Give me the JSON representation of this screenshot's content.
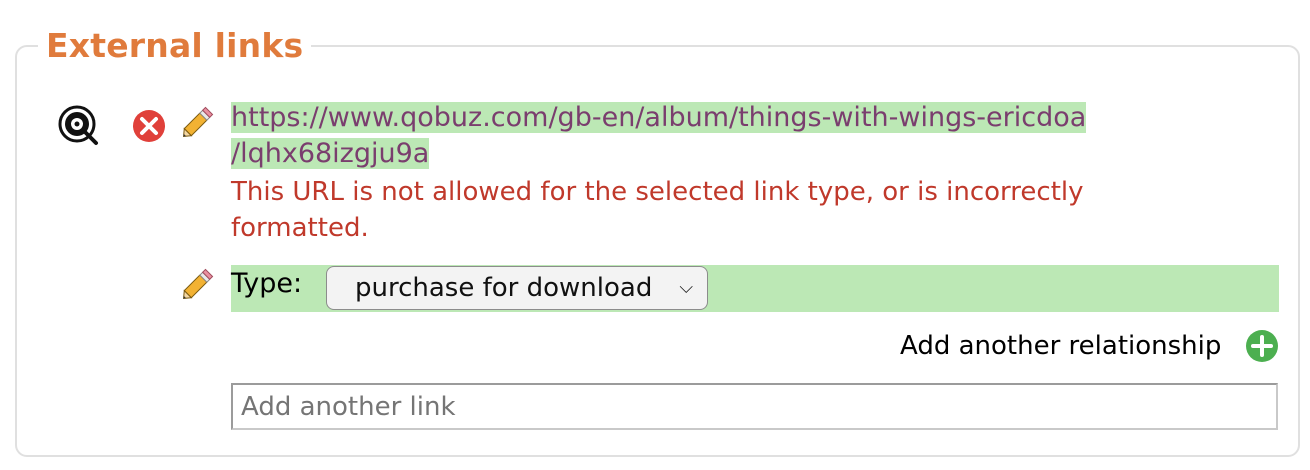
{
  "section": {
    "title": "External links"
  },
  "link": {
    "url_line1": "https://www.qobuz.com/gb-en/album/things-with-wings-ericdoa",
    "url_line2": "/lqhx68izgju9a",
    "error_line1": "This URL is not allowed for the selected link type, or is incorrectly",
    "error_line2": "formatted.",
    "site_icon": "qobuz-icon",
    "remove_icon": "remove-circle-icon",
    "edit_icon": "pencil-icon"
  },
  "relationship": {
    "type_label": "Type:",
    "type_value": "purchase for download",
    "add_another_label": "Add another relationship",
    "add_icon": "plus-circle-icon"
  },
  "add_link": {
    "placeholder": "Add another link"
  },
  "colors": {
    "accent": "#e07b3c",
    "highlight": "#bce8b5",
    "error": "#c0392b",
    "link": "#7a3e6e",
    "add_green": "#4caf50",
    "remove_red": "#e0403a"
  }
}
